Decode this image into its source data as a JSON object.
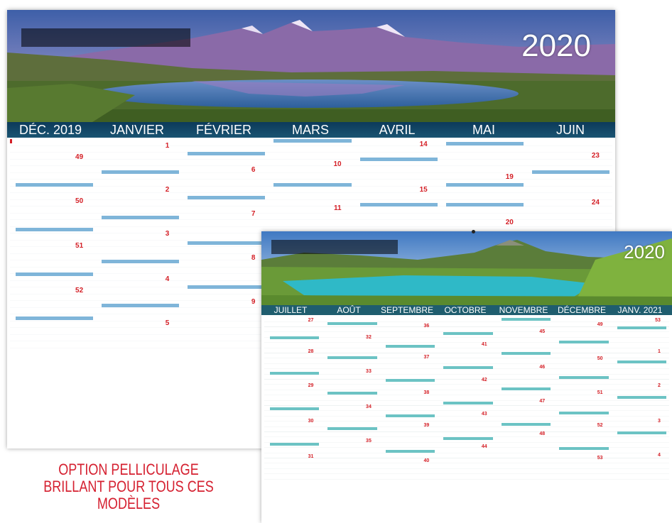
{
  "calendar_1": {
    "year": "2020",
    "months": [
      "DÉC. 2019",
      "JANVIER",
      "FÉVRIER",
      "MARS",
      "AVRIL",
      "MAI",
      "JUIN"
    ],
    "week_numbers": [
      [
        "49",
        "50",
        "51",
        "52"
      ],
      [
        "1",
        "2",
        "3",
        "4",
        "5"
      ],
      [
        "6",
        "7",
        "8",
        "9"
      ],
      [
        "10",
        "11"
      ],
      [
        "14",
        "15"
      ],
      [
        "19",
        "20"
      ],
      [
        "23",
        "24"
      ]
    ]
  },
  "calendar_2": {
    "year": "2020",
    "months": [
      "JUILLET",
      "AOÛT",
      "SEPTEMBRE",
      "OCTOBRE",
      "NOVEMBRE",
      "DÉCEMBRE",
      "JANV. 2021"
    ],
    "week_numbers": [
      [
        "27",
        "28",
        "29",
        "30",
        "31"
      ],
      [
        "32",
        "33",
        "34",
        "35"
      ],
      [
        "36",
        "37",
        "38",
        "39",
        "40"
      ],
      [
        "41",
        "42",
        "43",
        "44"
      ],
      [
        "45",
        "46",
        "47",
        "48"
      ],
      [
        "49",
        "50",
        "51",
        "52",
        "53"
      ],
      [
        "53",
        "1",
        "2",
        "3",
        "4"
      ]
    ]
  },
  "caption": {
    "line1": "OPTION PELLICULAGE",
    "line2": "BRILLANT POUR TOUS CES MODÈLES"
  },
  "colors": {
    "caption": "#d52030",
    "header_band_1": "#0c3a5a",
    "header_band_2": "#1f5d6e",
    "highlight_1": "#7fb5d9",
    "highlight_2": "#6cc3c4"
  }
}
